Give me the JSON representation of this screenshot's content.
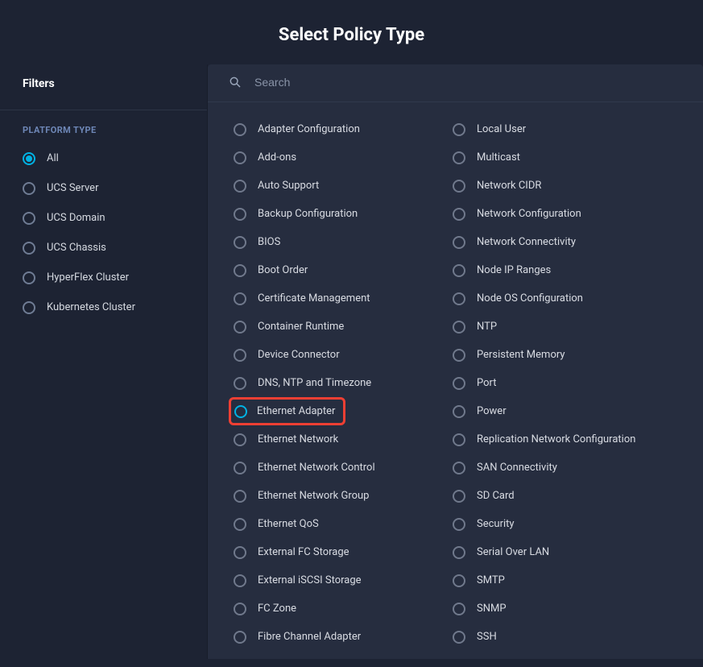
{
  "header": {
    "title": "Select Policy Type"
  },
  "sidebar": {
    "filters_label": "Filters",
    "platform_type_label": "PLATFORM TYPE",
    "filters": [
      {
        "label": "All",
        "selected": true
      },
      {
        "label": "UCS Server",
        "selected": false
      },
      {
        "label": "UCS Domain",
        "selected": false
      },
      {
        "label": "UCS Chassis",
        "selected": false
      },
      {
        "label": "HyperFlex Cluster",
        "selected": false
      },
      {
        "label": "Kubernetes Cluster",
        "selected": false
      }
    ]
  },
  "search": {
    "placeholder": "Search"
  },
  "policies_column_1": [
    {
      "label": "Adapter Configuration",
      "selected": false,
      "highlighted": false
    },
    {
      "label": "Add-ons",
      "selected": false,
      "highlighted": false
    },
    {
      "label": "Auto Support",
      "selected": false,
      "highlighted": false
    },
    {
      "label": "Backup Configuration",
      "selected": false,
      "highlighted": false
    },
    {
      "label": "BIOS",
      "selected": false,
      "highlighted": false
    },
    {
      "label": "Boot Order",
      "selected": false,
      "highlighted": false
    },
    {
      "label": "Certificate Management",
      "selected": false,
      "highlighted": false
    },
    {
      "label": "Container Runtime",
      "selected": false,
      "highlighted": false
    },
    {
      "label": "Device Connector",
      "selected": false,
      "highlighted": false
    },
    {
      "label": "DNS, NTP and Timezone",
      "selected": false,
      "highlighted": false
    },
    {
      "label": "Ethernet Adapter",
      "selected": true,
      "highlighted": true
    },
    {
      "label": "Ethernet Network",
      "selected": false,
      "highlighted": false
    },
    {
      "label": "Ethernet Network Control",
      "selected": false,
      "highlighted": false
    },
    {
      "label": "Ethernet Network Group",
      "selected": false,
      "highlighted": false
    },
    {
      "label": "Ethernet QoS",
      "selected": false,
      "highlighted": false
    },
    {
      "label": "External FC Storage",
      "selected": false,
      "highlighted": false
    },
    {
      "label": "External iSCSI Storage",
      "selected": false,
      "highlighted": false
    },
    {
      "label": "FC Zone",
      "selected": false,
      "highlighted": false
    },
    {
      "label": "Fibre Channel Adapter",
      "selected": false,
      "highlighted": false
    }
  ],
  "policies_column_2": [
    {
      "label": "Local User",
      "selected": false,
      "highlighted": false
    },
    {
      "label": "Multicast",
      "selected": false,
      "highlighted": false
    },
    {
      "label": "Network CIDR",
      "selected": false,
      "highlighted": false
    },
    {
      "label": "Network Configuration",
      "selected": false,
      "highlighted": false
    },
    {
      "label": "Network Connectivity",
      "selected": false,
      "highlighted": false
    },
    {
      "label": "Node IP Ranges",
      "selected": false,
      "highlighted": false
    },
    {
      "label": "Node OS Configuration",
      "selected": false,
      "highlighted": false
    },
    {
      "label": "NTP",
      "selected": false,
      "highlighted": false
    },
    {
      "label": "Persistent Memory",
      "selected": false,
      "highlighted": false
    },
    {
      "label": "Port",
      "selected": false,
      "highlighted": false
    },
    {
      "label": "Power",
      "selected": false,
      "highlighted": false
    },
    {
      "label": "Replication Network Configuration",
      "selected": false,
      "highlighted": false
    },
    {
      "label": "SAN Connectivity",
      "selected": false,
      "highlighted": false
    },
    {
      "label": "SD Card",
      "selected": false,
      "highlighted": false
    },
    {
      "label": "Security",
      "selected": false,
      "highlighted": false
    },
    {
      "label": "Serial Over LAN",
      "selected": false,
      "highlighted": false
    },
    {
      "label": "SMTP",
      "selected": false,
      "highlighted": false
    },
    {
      "label": "SNMP",
      "selected": false,
      "highlighted": false
    },
    {
      "label": "SSH",
      "selected": false,
      "highlighted": false
    }
  ]
}
